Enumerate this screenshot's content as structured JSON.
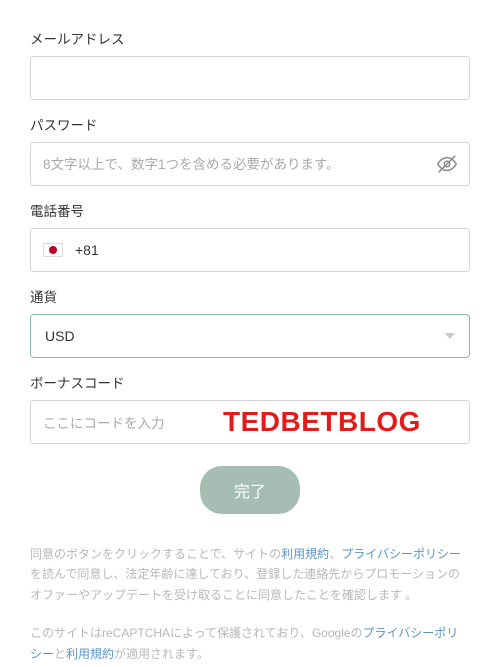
{
  "fields": {
    "email": {
      "label": "メールアドレス",
      "value": ""
    },
    "password": {
      "label": "パスワード",
      "placeholder": "8文字以上で、数字1つを含める必要があります。",
      "value": ""
    },
    "phone": {
      "label": "電話番号",
      "dial_code": "+81"
    },
    "currency": {
      "label": "通貨",
      "value": "USD"
    },
    "bonus": {
      "label": "ボーナスコード",
      "placeholder": "ここにコードを入力",
      "overlay": "TEDBETBLOG"
    }
  },
  "submit_label": "完了",
  "legal1": {
    "t1": "同意のボタンをクリックすることで、サイトの",
    "link_terms": "利用規約",
    "sep": "、",
    "link_privacy": "プライバシーポリシー",
    "t2": "を読んで同意し、法定年齢に達しており、登録した連絡先からプロモーションのオファーやアップデートを受け取ることに同意したことを確認します 。"
  },
  "legal2": {
    "t1": "このサイトはreCAPTCHAによって保護されており、Googleの",
    "link_privacy": "プライバシーポリシー",
    "t2": "と",
    "link_terms": "利用規約",
    "t3": "が適用されます。"
  }
}
